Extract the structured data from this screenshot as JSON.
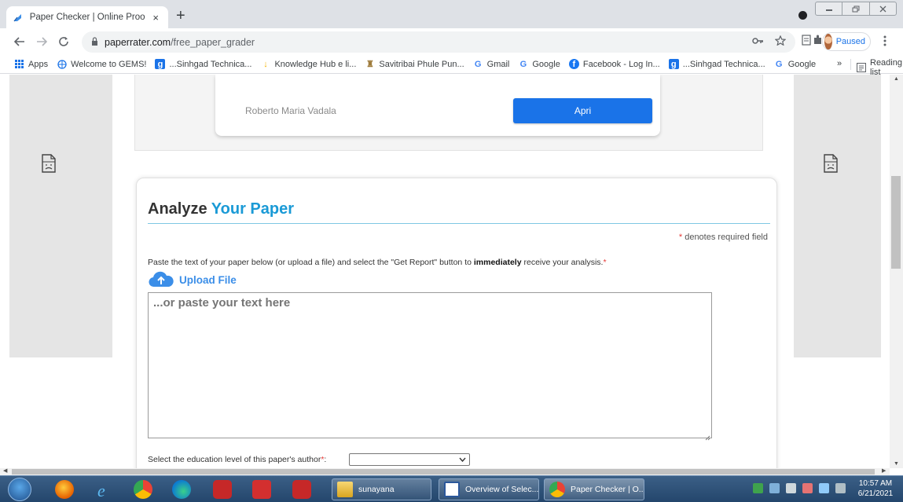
{
  "browser": {
    "tab_title": "Paper Checker | Online Proofreac",
    "tab_close": "×",
    "new_tab": "+",
    "url_host": "paperrater.com",
    "url_path": "/free_paper_grader",
    "profile_status": "Paused",
    "icons": [
      "back-icon",
      "forward-icon",
      "reload-icon",
      "lock-icon",
      "key-icon",
      "star-icon",
      "reading-mode-icon",
      "extensions-icon",
      "kebab-menu-icon"
    ]
  },
  "bookmarks": {
    "items": [
      {
        "label": "Apps",
        "icon": "apps-grid-icon",
        "color": "#1a73e8"
      },
      {
        "label": "Welcome to GEMS!",
        "icon": "gems-globe-icon",
        "color": "#1a73e8"
      },
      {
        "label": "...Sinhgad Technica...",
        "icon": "sinhgad-icon",
        "color": "#1a73e8"
      },
      {
        "label": "Knowledge Hub e li...",
        "icon": "knowledge-hub-icon",
        "color": "#f4b400"
      },
      {
        "label": "Savitribai Phule Pun...",
        "icon": "university-icon",
        "color": "#9e7b3b"
      },
      {
        "label": "Gmail",
        "icon": "google-g-icon",
        "color": "#4285f4"
      },
      {
        "label": "Google",
        "icon": "google-g-icon",
        "color": "#4285f4"
      },
      {
        "label": "Facebook - Log In...",
        "icon": "facebook-icon",
        "color": "#1877f2"
      },
      {
        "label": "...Sinhgad Technica...",
        "icon": "sinhgad-icon",
        "color": "#1a73e8"
      },
      {
        "label": "Google",
        "icon": "google-g-icon",
        "color": "#4285f4"
      }
    ],
    "more": "»",
    "reading_list": "Reading list"
  },
  "ad": {
    "name": "Roberto Maria Vadala",
    "button": "Apri"
  },
  "analyze": {
    "title_plain": "Analyze",
    "title_accent": "Your Paper",
    "required_star": "*",
    "required_note": "denotes required field",
    "instr_before": "Paste the text of your paper below (or upload a file) and select the \"Get Report\" button to ",
    "instr_bold": "immediately",
    "instr_after": " receive your analysis.",
    "instr_star": "*",
    "upload_label": "Upload File",
    "textarea_placeholder": "...or paste your text here",
    "edu_label": "Select the education level of this paper's author",
    "edu_star": "*",
    "edu_colon": ":",
    "edu_selected": ""
  },
  "taskbar": {
    "tasks": [
      {
        "label": "sunayana",
        "icon": "folder-icon"
      },
      {
        "label": "Overview of Selec...",
        "icon": "word-doc-icon"
      },
      {
        "label": "Paper Checker | O...",
        "icon": "chrome-icon"
      }
    ],
    "time": "10:57 AM",
    "date": "6/21/2021"
  },
  "colors": {
    "accent_blue": "#1a9ad6",
    "button_blue": "#1a73e8",
    "required_red": "#e53935"
  }
}
